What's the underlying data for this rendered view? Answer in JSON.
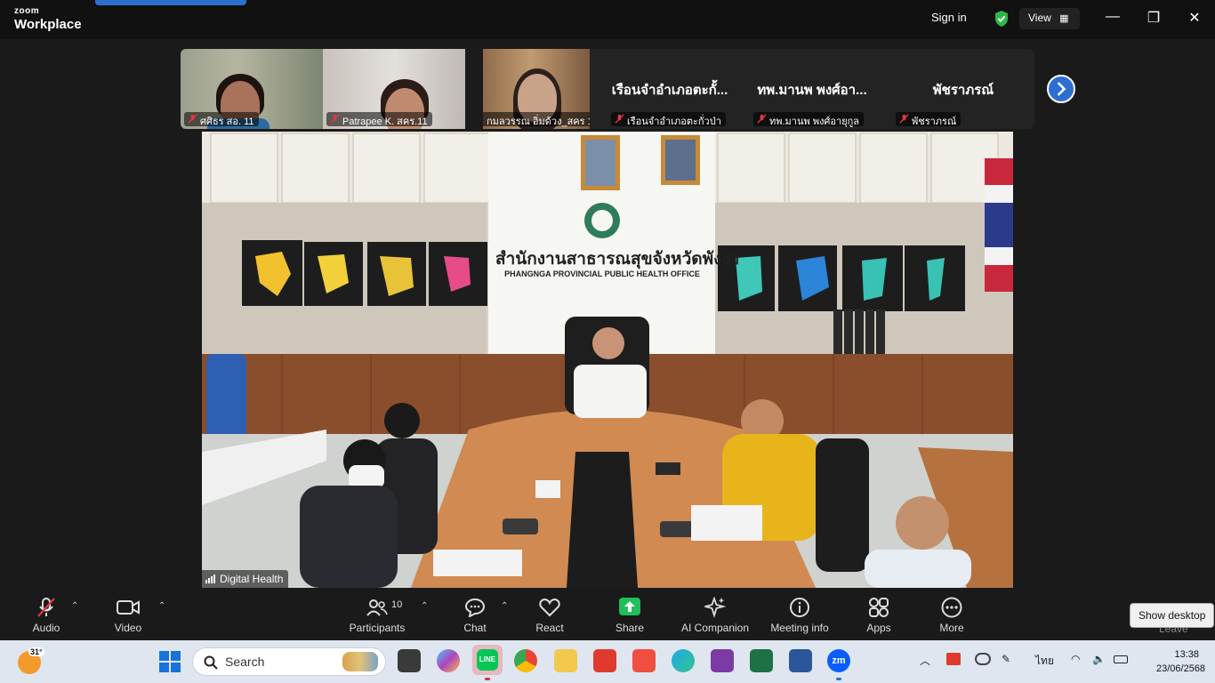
{
  "app": {
    "brand_top": "zoom",
    "brand_bottom": "Workplace"
  },
  "titlebar": {
    "sign_in": "Sign in",
    "view_label": "View"
  },
  "participants_strip": [
    {
      "name": "ศศิธร สอ. 11",
      "type": "video"
    },
    {
      "name": "Patrapee K. สคร.11",
      "type": "video"
    },
    {
      "name": "กมลวรรณ อิ่มด้วง_สคร 11",
      "type": "video"
    },
    {
      "display": "เรือนจำอำเภอตะกั้...",
      "name": "เรือนจำอำเภอตะกั่วป่า",
      "type": "name"
    },
    {
      "display": "ทพ.มานพ พงศ์อา...",
      "name": "ทพ.มานพ พงศ์อายุกูล",
      "type": "name"
    },
    {
      "display": "พัชราภรณ์",
      "name": "พัชราภรณ์",
      "type": "name"
    }
  ],
  "main_video": {
    "speaker": "Digital Health",
    "sign_th": "สำนักงานสาธารณสุขจังหวัดพังงา",
    "sign_en": "PHANGNGA PROVINCIAL PUBLIC HEALTH OFFICE"
  },
  "toolbar": {
    "audio": "Audio",
    "video": "Video",
    "participants": "Participants",
    "participants_count": "10",
    "chat": "Chat",
    "react": "React",
    "share": "Share",
    "ai_companion": "AI Companion",
    "meeting_info": "Meeting info",
    "apps": "Apps",
    "more": "More",
    "leave": "Leave"
  },
  "tooltip": "Show desktop",
  "taskbar": {
    "temperature": "31°",
    "search_placeholder": "Search",
    "language": "ไทย",
    "time": "13:38",
    "date": "23/06/2568"
  },
  "colors": {
    "accent": "#2d6fd1",
    "share_green": "#1fbf5a",
    "mute_red": "#e0393e"
  }
}
